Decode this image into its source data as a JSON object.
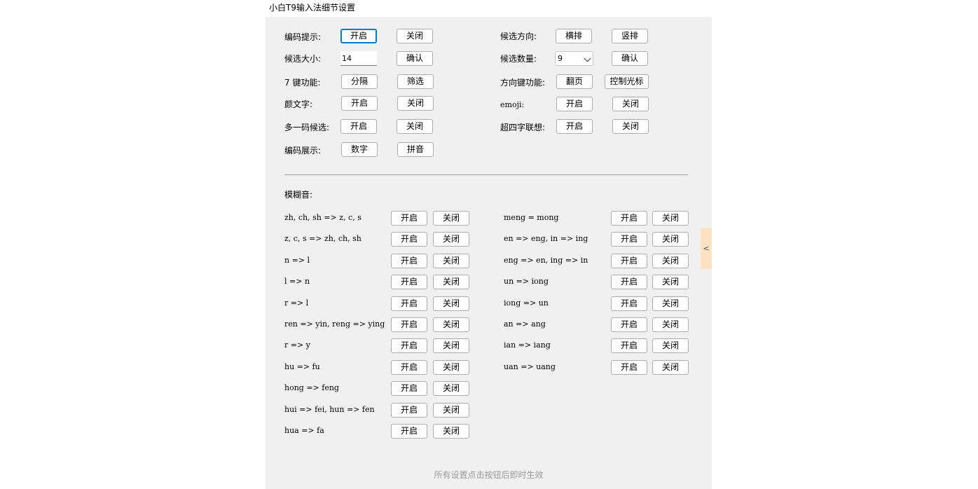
{
  "window": {
    "title": "小白T9输入法细节设置"
  },
  "settings": {
    "coding_hint": {
      "label": "编码提示:",
      "on": "开启",
      "off": "关闭"
    },
    "candidate_direction": {
      "label": "候选方向:",
      "horizontal": "横排",
      "vertical": "竖排"
    },
    "candidate_size": {
      "label": "候选大小:",
      "value": "14",
      "confirm": "确认"
    },
    "candidate_count": {
      "label": "候选数量:",
      "value": "9",
      "confirm": "确认"
    },
    "key7_function": {
      "label": "7 键功能:",
      "separate": "分隔",
      "filter": "筛选"
    },
    "arrow_function": {
      "label": "方向键功能:",
      "page": "翻页",
      "cursor": "控制光标"
    },
    "kaomoji": {
      "label": "颜文字:",
      "on": "开启",
      "off": "关闭"
    },
    "emoji": {
      "label": "emoji:",
      "on": "开启",
      "off": "关闭"
    },
    "multi_code": {
      "label": "多一码候选:",
      "on": "开启",
      "off": "关闭"
    },
    "super_four": {
      "label": "超四字联想:",
      "on": "开启",
      "off": "关闭"
    },
    "code_display": {
      "label": "编码展示:",
      "digits": "数字",
      "pinyin": "拼音"
    }
  },
  "fuzzy": {
    "heading": "模糊音:",
    "on": "开启",
    "off": "关闭",
    "left": [
      "zh, ch, sh => z, c, s",
      "z, c, s => zh, ch, sh",
      "n => l",
      "l => n",
      "r => l",
      "ren => yin, reng => ying",
      "r => y",
      "hu => fu",
      "hong => feng",
      "hui => fei, hun => fen",
      "hua => fa"
    ],
    "right": [
      "meng = mong",
      "en => eng, in => ing",
      "eng => en, ing => in",
      "un => iong",
      "iong => un",
      "an => ang",
      "ian => iang",
      "uan => uang"
    ]
  },
  "footer": "所有设置点击按钮后即时生效",
  "sidetab": "<"
}
